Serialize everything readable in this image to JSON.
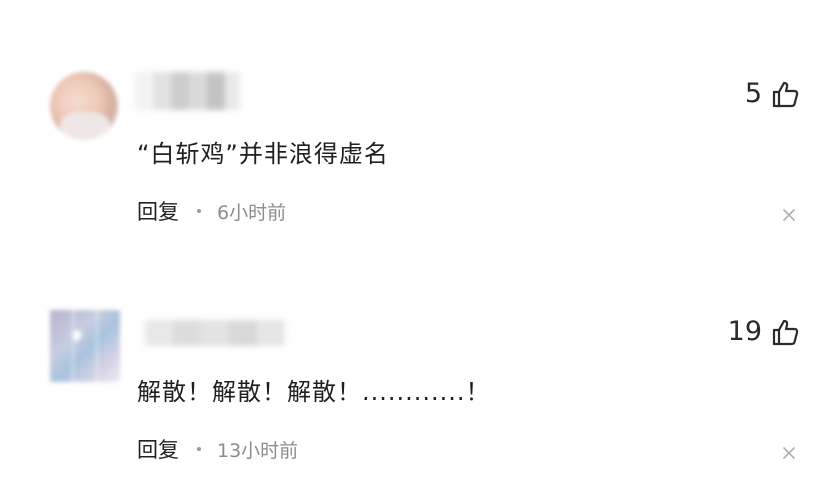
{
  "comments": [
    {
      "text": "“白斩鸡”并非浪得虚名",
      "likes": "5",
      "reply_label": "回复",
      "time": "6小时前",
      "username_blocks": [
        "#f3f3f3",
        "#e2e2e2",
        "#cdcdcd",
        "#dadada",
        "#c4c4c4",
        "#e9e9e9"
      ]
    },
    {
      "text": "解散！解散！解散！............！",
      "likes": "19",
      "reply_label": "回复",
      "time": "13小时前",
      "username_blocks": [
        "#e8e8e8",
        "#dcdcdc",
        "#e3e3e3",
        "#d9d9d9",
        "#e6e6e6"
      ]
    }
  ],
  "icons": {
    "like": "thumbs-up-icon",
    "close": "close-icon",
    "separator": "dot-separator"
  },
  "colors": {
    "text_primary": "#1f1f1f",
    "text_secondary": "#8c8c8c",
    "icon": "#2b2b2b"
  }
}
